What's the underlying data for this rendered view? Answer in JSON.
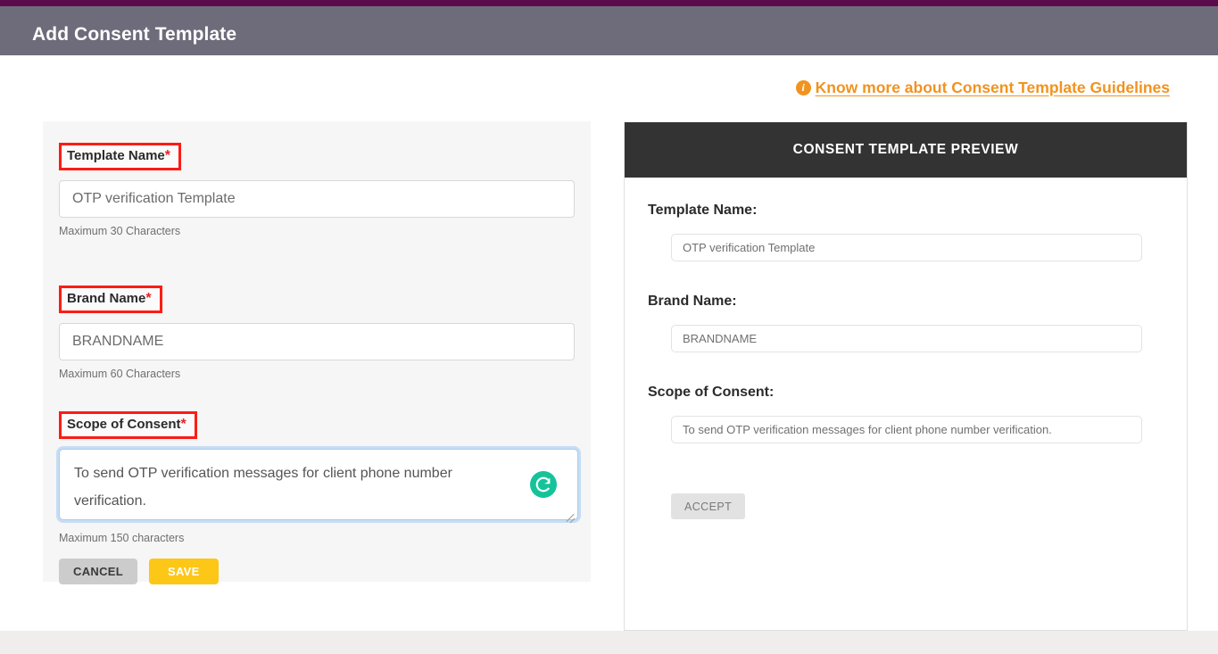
{
  "header": {
    "title": "Add Consent Template",
    "accent_color": "#5b0b4c",
    "bar_color": "#6e6b7b"
  },
  "guidelines": {
    "icon": "info-icon",
    "text": "Know more about Consent Template Guidelines",
    "color": "#f1931f"
  },
  "form": {
    "template_name": {
      "label": "Template Name",
      "required_marker": "*",
      "value": "OTP verification Template",
      "placeholder": "OTP verification Template",
      "helper": "Maximum 30 Characters"
    },
    "brand_name": {
      "label": "Brand Name",
      "required_marker": "*",
      "value": "BRANDNAME",
      "placeholder": "BRANDNAME",
      "helper": "Maximum 60 Characters"
    },
    "scope_of_consent": {
      "label": "Scope of Consent",
      "required_marker": "*",
      "value": "To send OTP verification messages for client phone number verification.",
      "placeholder": "To send OTP verification messages for client phone number verification.",
      "helper": "Maximum 150 characters",
      "assistant_icon": "grammarly-icon",
      "assistant_color": "#15c39a",
      "focused": true
    },
    "buttons": {
      "cancel": "CANCEL",
      "save": "SAVE",
      "cancel_color": "#cccccc",
      "save_color": "#fcc717"
    },
    "annotation_box_color": "#fd1c14"
  },
  "preview": {
    "title": "CONSENT TEMPLATE PREVIEW",
    "header_color": "#333333",
    "fields": [
      {
        "label": "Template Name:",
        "value": "OTP verification Template"
      },
      {
        "label": "Brand Name:",
        "value": "BRANDNAME"
      },
      {
        "label": "Scope of Consent:",
        "value": "To send OTP verification messages for client phone number verification."
      }
    ],
    "accept_label": "ACCEPT"
  }
}
